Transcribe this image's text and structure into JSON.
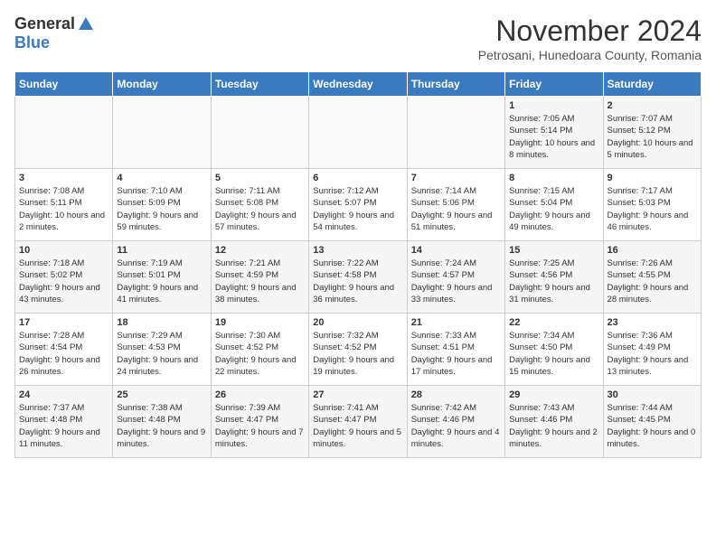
{
  "logo": {
    "general": "General",
    "blue": "Blue"
  },
  "title": "November 2024",
  "subtitle": "Petrosani, Hunedoara County, Romania",
  "days_header": [
    "Sunday",
    "Monday",
    "Tuesday",
    "Wednesday",
    "Thursday",
    "Friday",
    "Saturday"
  ],
  "weeks": [
    [
      {
        "day": "",
        "info": ""
      },
      {
        "day": "",
        "info": ""
      },
      {
        "day": "",
        "info": ""
      },
      {
        "day": "",
        "info": ""
      },
      {
        "day": "",
        "info": ""
      },
      {
        "day": "1",
        "info": "Sunrise: 7:05 AM\nSunset: 5:14 PM\nDaylight: 10 hours and 8 minutes."
      },
      {
        "day": "2",
        "info": "Sunrise: 7:07 AM\nSunset: 5:12 PM\nDaylight: 10 hours and 5 minutes."
      }
    ],
    [
      {
        "day": "3",
        "info": "Sunrise: 7:08 AM\nSunset: 5:11 PM\nDaylight: 10 hours and 2 minutes."
      },
      {
        "day": "4",
        "info": "Sunrise: 7:10 AM\nSunset: 5:09 PM\nDaylight: 9 hours and 59 minutes."
      },
      {
        "day": "5",
        "info": "Sunrise: 7:11 AM\nSunset: 5:08 PM\nDaylight: 9 hours and 57 minutes."
      },
      {
        "day": "6",
        "info": "Sunrise: 7:12 AM\nSunset: 5:07 PM\nDaylight: 9 hours and 54 minutes."
      },
      {
        "day": "7",
        "info": "Sunrise: 7:14 AM\nSunset: 5:06 PM\nDaylight: 9 hours and 51 minutes."
      },
      {
        "day": "8",
        "info": "Sunrise: 7:15 AM\nSunset: 5:04 PM\nDaylight: 9 hours and 49 minutes."
      },
      {
        "day": "9",
        "info": "Sunrise: 7:17 AM\nSunset: 5:03 PM\nDaylight: 9 hours and 46 minutes."
      }
    ],
    [
      {
        "day": "10",
        "info": "Sunrise: 7:18 AM\nSunset: 5:02 PM\nDaylight: 9 hours and 43 minutes."
      },
      {
        "day": "11",
        "info": "Sunrise: 7:19 AM\nSunset: 5:01 PM\nDaylight: 9 hours and 41 minutes."
      },
      {
        "day": "12",
        "info": "Sunrise: 7:21 AM\nSunset: 4:59 PM\nDaylight: 9 hours and 38 minutes."
      },
      {
        "day": "13",
        "info": "Sunrise: 7:22 AM\nSunset: 4:58 PM\nDaylight: 9 hours and 36 minutes."
      },
      {
        "day": "14",
        "info": "Sunrise: 7:24 AM\nSunset: 4:57 PM\nDaylight: 9 hours and 33 minutes."
      },
      {
        "day": "15",
        "info": "Sunrise: 7:25 AM\nSunset: 4:56 PM\nDaylight: 9 hours and 31 minutes."
      },
      {
        "day": "16",
        "info": "Sunrise: 7:26 AM\nSunset: 4:55 PM\nDaylight: 9 hours and 28 minutes."
      }
    ],
    [
      {
        "day": "17",
        "info": "Sunrise: 7:28 AM\nSunset: 4:54 PM\nDaylight: 9 hours and 26 minutes."
      },
      {
        "day": "18",
        "info": "Sunrise: 7:29 AM\nSunset: 4:53 PM\nDaylight: 9 hours and 24 minutes."
      },
      {
        "day": "19",
        "info": "Sunrise: 7:30 AM\nSunset: 4:52 PM\nDaylight: 9 hours and 22 minutes."
      },
      {
        "day": "20",
        "info": "Sunrise: 7:32 AM\nSunset: 4:52 PM\nDaylight: 9 hours and 19 minutes."
      },
      {
        "day": "21",
        "info": "Sunrise: 7:33 AM\nSunset: 4:51 PM\nDaylight: 9 hours and 17 minutes."
      },
      {
        "day": "22",
        "info": "Sunrise: 7:34 AM\nSunset: 4:50 PM\nDaylight: 9 hours and 15 minutes."
      },
      {
        "day": "23",
        "info": "Sunrise: 7:36 AM\nSunset: 4:49 PM\nDaylight: 9 hours and 13 minutes."
      }
    ],
    [
      {
        "day": "24",
        "info": "Sunrise: 7:37 AM\nSunset: 4:48 PM\nDaylight: 9 hours and 11 minutes."
      },
      {
        "day": "25",
        "info": "Sunrise: 7:38 AM\nSunset: 4:48 PM\nDaylight: 9 hours and 9 minutes."
      },
      {
        "day": "26",
        "info": "Sunrise: 7:39 AM\nSunset: 4:47 PM\nDaylight: 9 hours and 7 minutes."
      },
      {
        "day": "27",
        "info": "Sunrise: 7:41 AM\nSunset: 4:47 PM\nDaylight: 9 hours and 5 minutes."
      },
      {
        "day": "28",
        "info": "Sunrise: 7:42 AM\nSunset: 4:46 PM\nDaylight: 9 hours and 4 minutes."
      },
      {
        "day": "29",
        "info": "Sunrise: 7:43 AM\nSunset: 4:46 PM\nDaylight: 9 hours and 2 minutes."
      },
      {
        "day": "30",
        "info": "Sunrise: 7:44 AM\nSunset: 4:45 PM\nDaylight: 9 hours and 0 minutes."
      }
    ]
  ]
}
